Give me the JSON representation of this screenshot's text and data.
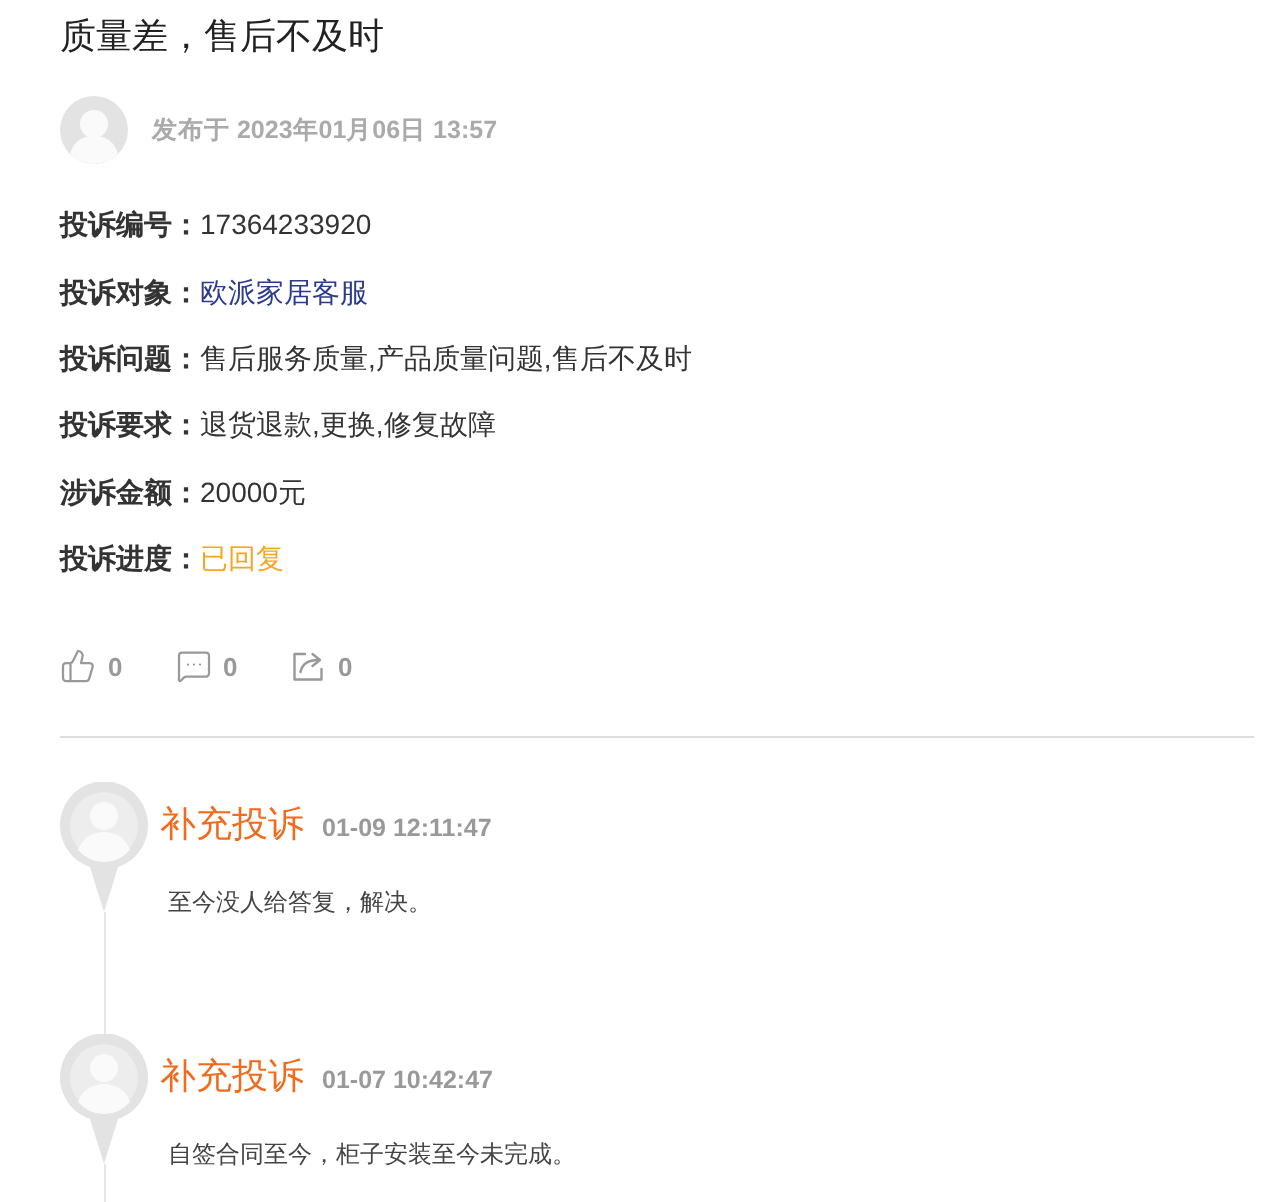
{
  "title": "质量差，售后不及时",
  "post": {
    "date": "发布于 2023年01月06日 13:57"
  },
  "details": [
    {
      "label": "投诉编号：",
      "value": "17364233920",
      "kind": "plain"
    },
    {
      "label": "投诉对象：",
      "value": "欧派家居客服",
      "kind": "link"
    },
    {
      "label": "投诉问题：",
      "value": "售后服务质量,产品质量问题,售后不及时",
      "kind": "plain"
    },
    {
      "label": "投诉要求：",
      "value": "退货退款,更换,修复故障",
      "kind": "plain"
    },
    {
      "label": "涉诉金额：",
      "value": "20000元",
      "kind": "plain"
    },
    {
      "label": "投诉进度：",
      "value": "已回复",
      "kind": "status"
    }
  ],
  "actions": [
    {
      "kind": "like",
      "count": "0"
    },
    {
      "kind": "comment",
      "count": "0"
    },
    {
      "kind": "share",
      "count": "0"
    }
  ],
  "timeline": [
    {
      "title": "补充投诉",
      "time": "01-09 12:11:47",
      "text": "至今没人给答复，解决。"
    },
    {
      "title": "补充投诉",
      "time": "01-07 10:42:47",
      "text": "自签合同至今，柜子安装至今未完成。"
    }
  ]
}
